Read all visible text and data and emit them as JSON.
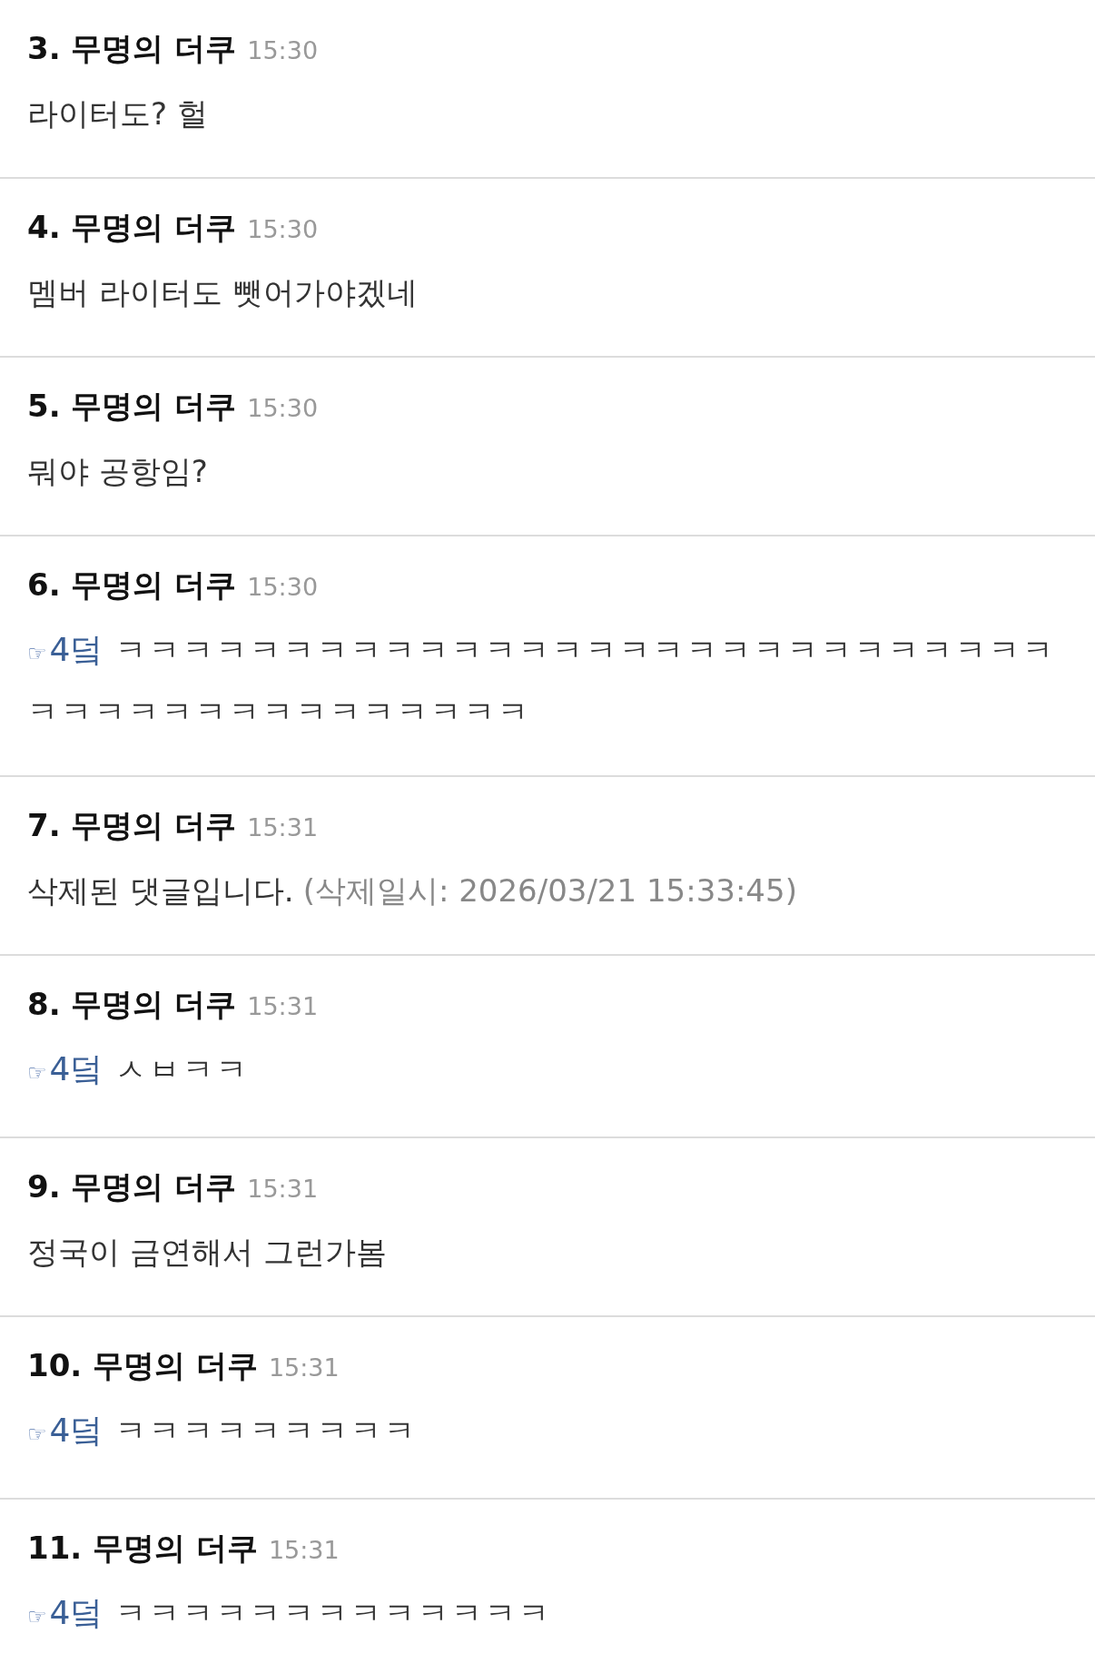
{
  "comments": [
    {
      "number": "3.",
      "author": "무명의 더쿠",
      "time": "15:30",
      "kind": "text",
      "text": "라이터도? 헐"
    },
    {
      "number": "4.",
      "author": "무명의 더쿠",
      "time": "15:30",
      "kind": "text",
      "text": "멤버 라이터도 뺏어가야겠네"
    },
    {
      "number": "5.",
      "author": "무명의 더쿠",
      "time": "15:30",
      "kind": "text",
      "text": "뭐야 공항임?"
    },
    {
      "number": "6.",
      "author": "무명의 더쿠",
      "time": "15:30",
      "kind": "reply",
      "hand": "☞",
      "reply_to": "4덬",
      "text": "ㅋㅋㅋㅋㅋㅋㅋㅋㅋㅋㅋㅋㅋㅋㅋㅋㅋㅋㅋㅋㅋㅋㅋㅋㅋㅋㅋㅋㅋㅋㅋㅋㅋㅋㅋㅋㅋㅋㅋㅋㅋㅋㅋ"
    },
    {
      "number": "7.",
      "author": "무명의 더쿠",
      "time": "15:31",
      "kind": "deleted",
      "text": "삭제된 댓글입니다.",
      "note": "(삭제일시: 2026/03/21 15:33:45)"
    },
    {
      "number": "8.",
      "author": "무명의 더쿠",
      "time": "15:31",
      "kind": "reply",
      "hand": "☞",
      "reply_to": "4덬",
      "text": "ㅅㅂㅋㅋ"
    },
    {
      "number": "9.",
      "author": "무명의 더쿠",
      "time": "15:31",
      "kind": "text",
      "text": "정국이 금연해서 그런가봄"
    },
    {
      "number": "10.",
      "author": "무명의 더쿠",
      "time": "15:31",
      "kind": "reply",
      "hand": "☞",
      "reply_to": "4덬",
      "text": "ㅋㅋㅋㅋㅋㅋㅋㅋㅋ"
    },
    {
      "number": "11.",
      "author": "무명의 더쿠",
      "time": "15:31",
      "kind": "reply",
      "hand": "☞",
      "reply_to": "4덬",
      "text": "ㅋㅋㅋㅋㅋㅋㅋㅋㅋㅋㅋㅋㅋ"
    }
  ]
}
